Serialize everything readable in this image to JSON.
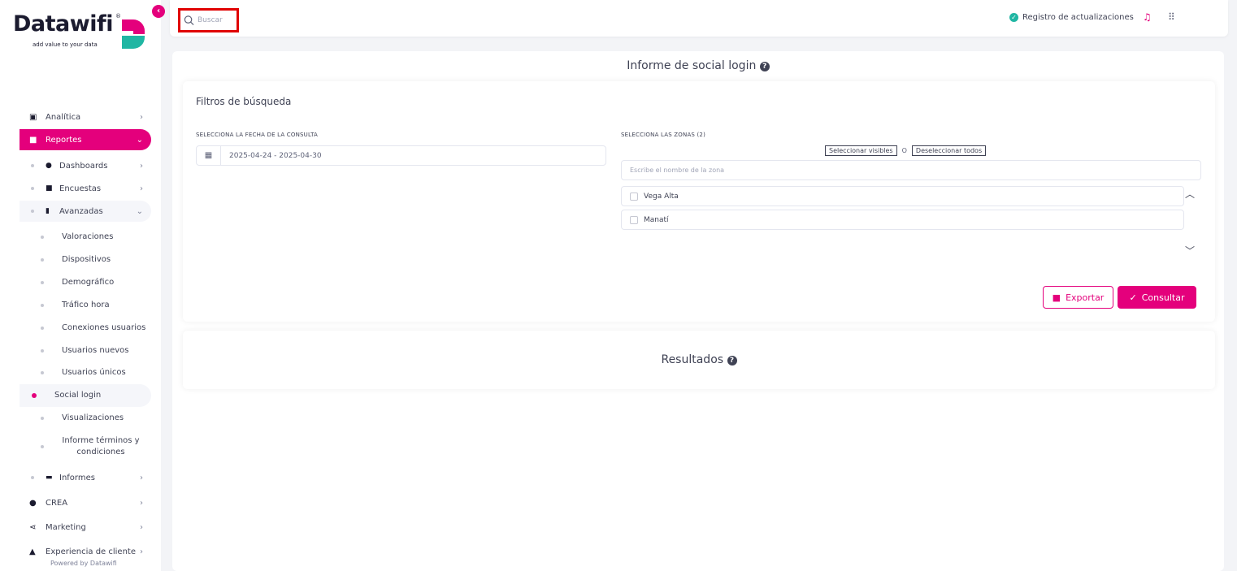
{
  "brand": {
    "name": "Datawifi",
    "registered": "®",
    "tagline": "add value to your data",
    "collapse_icon": "chevron-left-icon"
  },
  "colors": {
    "accent": "#e4007c",
    "teal": "#20b6a3",
    "highlight_box": "#e00000"
  },
  "topbar": {
    "search_placeholder": "Buscar",
    "changelog_label": "Registro de actualizaciones"
  },
  "sidebar": {
    "analitica": "Analítica",
    "reportes": "Reportes",
    "dashboards": "Dashboards",
    "encuestas": "Encuestas",
    "avanzadas": "Avanzadas",
    "leaves": [
      "Valoraciones",
      "Dispositivos",
      "Demográfico",
      "Tráfico hora",
      "Conexiones usuarios",
      "Usuarios nuevos",
      "Usuarios únicos",
      "Social login",
      "Visualizaciones",
      "Informe términos y condiciones"
    ],
    "informes": "Informes",
    "crea": "CREA",
    "marketing": "Marketing",
    "experiencia": "Experiencia de cliente",
    "powered": "Powered by Datawifi"
  },
  "main": {
    "title": "Informe de social login",
    "filters_title": "Filtros de búsqueda",
    "date_label": "SELECCIONA LA FECHA DE LA CONSULTA",
    "date_value": "2025-04-24 - 2025-04-30",
    "zones_label": "SELECCIONA LAS ZONAS (2)",
    "select_visible": "Seleccionar visibles",
    "or": "O",
    "deselect_all": "Deseleccionar todos",
    "zone_placeholder": "Escribe el nombre de la zona",
    "zones": [
      "Vega Alta",
      "Manatí"
    ],
    "export_label": "Exportar",
    "consult_label": "Consultar",
    "results_title": "Resultados"
  }
}
